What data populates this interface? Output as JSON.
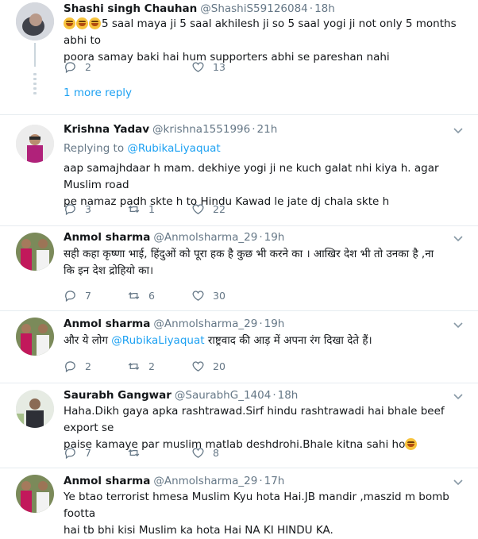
{
  "colors": {
    "link": "#1da1f2",
    "muted": "#657786",
    "divider": "#e6ecf0",
    "text": "#14171a"
  },
  "icons": {
    "reply": "reply-icon",
    "retweet": "retweet-icon",
    "like": "heart-icon",
    "menu": "chevron-down-icon"
  },
  "tweets": [
    {
      "name": "Shashi singh Chauhan",
      "handle": "@ShashiS59126084",
      "dot": "·",
      "time": "18h",
      "text_line1": "5 saal maya ji 5 saal akhilesh ji so 5 saal yogi ji not only 5 months abhi to",
      "text_line2": "poora samay baki hai hum supporters abhi se pareshan nahi",
      "replies": "2",
      "retweets": "",
      "likes": "13",
      "more_replies": "1 more reply"
    },
    {
      "name": "Krishna Yadav",
      "handle": "@krishna1551996",
      "dot": "·",
      "time": "21h",
      "replying_to_label": "Replying to",
      "replying_to_handle": "@RubikaLiyaquat",
      "text_line1": "aap samajhdaar h mam. dekhiye yogi ji ne kuch galat nhi kiya h. agar Muslim road",
      "text_line2": "pe namaz padh skte h to Hindu Kawad le jate dj chala skte h",
      "replies": "3",
      "retweets": "1",
      "likes": "22"
    },
    {
      "name": "Anmol sharma",
      "handle": "@Anmolsharma_29",
      "dot": "·",
      "time": "19h",
      "text_line1": "सही कहा कृष्णा भाई, हिंदुओं को पूरा हक है कुछ भी करने का । आखिर देश भी तो उनका है ,ना",
      "text_line2": "कि इन देश द्रोहियो का।",
      "replies": "7",
      "retweets": "6",
      "likes": "30"
    },
    {
      "name": "Anmol sharma",
      "handle": "@Anmolsharma_29",
      "dot": "·",
      "time": "19h",
      "text_prefix": "और ये लोग",
      "text_mention": "@RubikaLiyaquat",
      "text_suffix": "राष्ट्रवाद की आड़ में अपना रंग दिखा देते हैं।",
      "replies": "2",
      "retweets": "2",
      "likes": "20"
    },
    {
      "name": "Saurabh Gangwar",
      "handle": "@SaurabhG_1404",
      "dot": "·",
      "time": "18h",
      "text_line1": "Haha.Dikh gaya apka rashtrawad.Sirf hindu rashtrawadi hai bhale beef export se",
      "text_line2": "paise kamaye par muslim matlab deshdrohi.Bhale kitna sahi ho",
      "replies": "7",
      "retweets": "",
      "likes": "8"
    },
    {
      "name": "Anmol sharma",
      "handle": "@Anmolsharma_29",
      "dot": "·",
      "time": "17h",
      "text_line1": "Ye btao terrorist hmesa Muslim Kyu hota Hai.JB mandir ,maszid m bomb footta",
      "text_line2": "hai tb bhi kisi Muslim ka hota Hai NA KI HINDU KA."
    }
  ]
}
